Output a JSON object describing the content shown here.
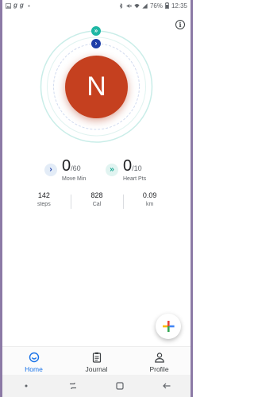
{
  "status_bar": {
    "battery": "76%",
    "time": "12:35"
  },
  "avatar": {
    "initial": "N"
  },
  "goals": {
    "move": {
      "value": "0",
      "target": "/60",
      "label": "Move Min"
    },
    "heart": {
      "value": "0",
      "target": "/10",
      "label": "Heart Pts"
    }
  },
  "stats": [
    {
      "value": "142",
      "unit": "steps"
    },
    {
      "value": "828",
      "unit": "Cal"
    },
    {
      "value": "0.09",
      "unit": "km"
    }
  ],
  "nav": {
    "home": "Home",
    "journal": "Journal",
    "profile": "Profile",
    "active": "home"
  },
  "colors": {
    "avatar": "#c5401f",
    "heart_ring": "#1eb7a4",
    "move_ring": "#1f3fa8",
    "accent": "#1a73e8"
  }
}
